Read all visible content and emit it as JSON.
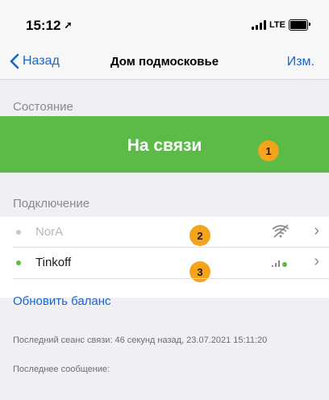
{
  "status_bar": {
    "time": "15:12",
    "location_arrow": "➚",
    "network": "LTE"
  },
  "nav": {
    "back_label": "Назад",
    "title": "Дом подмосковье",
    "edit_label": "Изм."
  },
  "state_section": {
    "header": "Состояние",
    "status_text": "На связи",
    "badge": "1",
    "status_color": "#5cba46"
  },
  "connection_section": {
    "header": "Подключение",
    "items": [
      {
        "name": "NorA",
        "active": false,
        "dot_color": "#c7c7cc",
        "icon": "wifi-off-icon",
        "badge": "2"
      },
      {
        "name": "Tinkoff",
        "active": true,
        "dot_color": "#5cba46",
        "icon": "cellular-signal-icon",
        "badge": "3"
      }
    ],
    "refresh_label": "Обновить баланс"
  },
  "footer": {
    "last_session": "Последний сеанс связи: 46 секунд назад, 23.07.2021 15:11:20",
    "last_message": "Последнее сообщение:"
  },
  "colors": {
    "accent": "#1466d2",
    "badge": "#f4a31c"
  }
}
